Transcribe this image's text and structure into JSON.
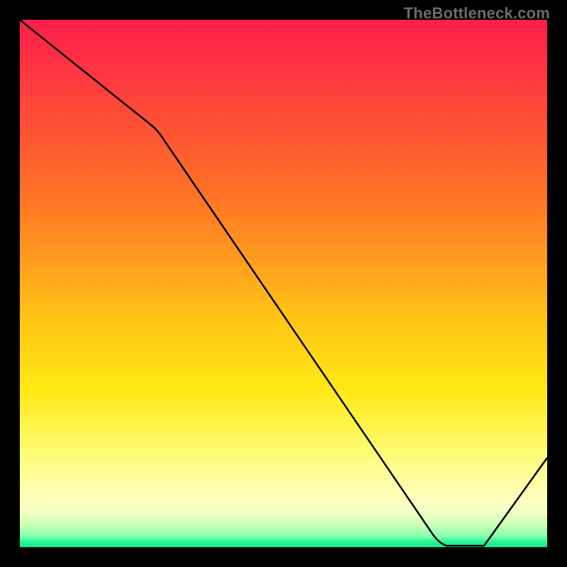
{
  "watermark": {
    "text": "TheBottleneck.com"
  },
  "marker": {
    "label": ""
  },
  "chart_data": {
    "type": "line",
    "title": "",
    "xlabel": "",
    "ylabel": "",
    "xlim": [
      0,
      100
    ],
    "ylim": [
      0,
      100
    ],
    "grid": false,
    "series": [
      {
        "name": "curve",
        "x": [
          0,
          25,
          78,
          82,
          88,
          100
        ],
        "values": [
          100,
          80,
          3,
          0,
          0,
          17
        ]
      }
    ],
    "gradient_stops": [
      {
        "pct": 0,
        "color": "#fc1e4a"
      },
      {
        "pct": 10,
        "color": "#fd3641"
      },
      {
        "pct": 36,
        "color": "#ff7b24"
      },
      {
        "pct": 56,
        "color": "#ffc216"
      },
      {
        "pct": 70,
        "color": "#ffe913"
      },
      {
        "pct": 82,
        "color": "#fffc73"
      },
      {
        "pct": 89,
        "color": "#ffffb0"
      },
      {
        "pct": 93,
        "color": "#f6ffc8"
      },
      {
        "pct": 96,
        "color": "#c9ffb5"
      },
      {
        "pct": 98,
        "color": "#7dffab"
      },
      {
        "pct": 99,
        "color": "#29f598"
      },
      {
        "pct": 100,
        "color": "#10e890"
      }
    ],
    "optimal_zone_x": [
      78,
      88
    ]
  }
}
